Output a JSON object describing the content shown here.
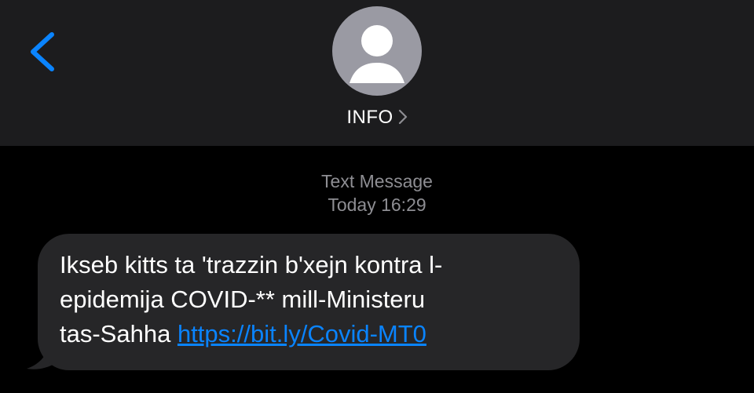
{
  "header": {
    "back_icon": "chevron-left-icon",
    "contact_name": "INFO",
    "avatar_icon": "person-silhouette-icon",
    "details_icon": "chevron-right-icon"
  },
  "conversation": {
    "service_label": "Text Message",
    "timestamp": "Today 16:29"
  },
  "message": {
    "direction": "incoming",
    "lines": [
      "Ikseb kitts ta 'trazzin b'xejn kontra l-",
      "epidemija COVID-** mill-Ministeru",
      "tas-Sahha "
    ],
    "link_text": "https://bit.ly/Covid-MT0"
  },
  "colors": {
    "header_bg": "#1c1c1e",
    "screen_bg": "#000000",
    "bubble_bg": "#262628",
    "accent": "#0a84ff",
    "secondary_text": "#8e8e93",
    "avatar_bg": "#9a9aa3"
  }
}
